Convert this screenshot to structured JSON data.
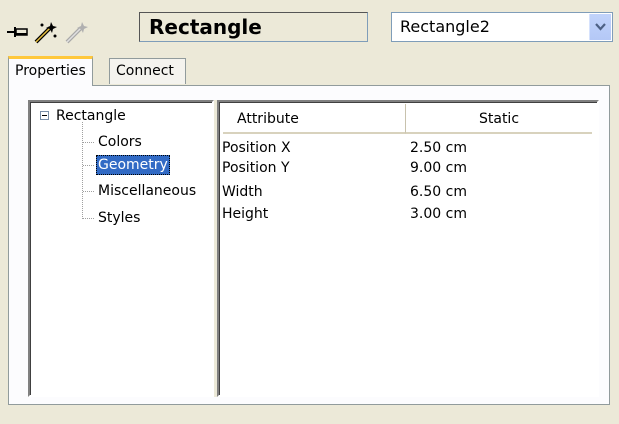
{
  "toolbar": {
    "icons": [
      "pin-icon",
      "magic-wand-icon",
      "magic-wand-disabled-icon"
    ],
    "object_title": "Rectangle",
    "object_select": {
      "value": "Rectangle2"
    }
  },
  "tabs": [
    {
      "label": "Properties",
      "active": true
    },
    {
      "label": "Connect",
      "active": false
    }
  ],
  "tree": {
    "root": "Rectangle",
    "children": [
      "Colors",
      "Geometry",
      "Miscellaneous",
      "Styles"
    ],
    "selected": "Geometry"
  },
  "table": {
    "columns": [
      "Attribute",
      "Static"
    ],
    "rows": [
      {
        "attribute": "Position X",
        "value": "2.50 cm"
      },
      {
        "attribute": "Position Y",
        "value": "9.00 cm"
      },
      {
        "attribute": "Width",
        "value": "6.50 cm"
      },
      {
        "attribute": "Height",
        "value": "3.00 cm"
      }
    ]
  },
  "colors": {
    "selection": "#316ac5",
    "active_tab_accent": "#ffc83c",
    "dialog_bg": "#ece9d8"
  }
}
